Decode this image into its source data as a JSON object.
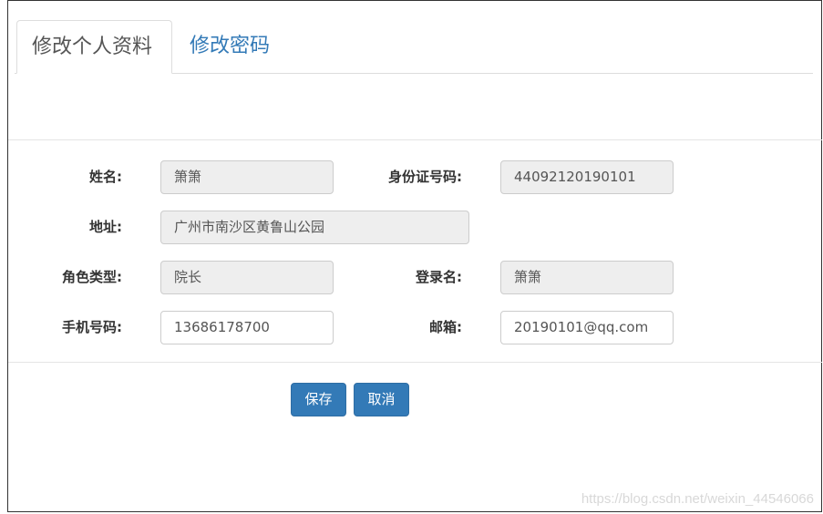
{
  "tabs": [
    {
      "label": "修改个人资料",
      "active": true
    },
    {
      "label": "修改密码",
      "active": false
    }
  ],
  "form": {
    "name": {
      "label": "姓名:",
      "value": "箫箫",
      "disabled": true
    },
    "id_card": {
      "label": "身份证号码:",
      "value": "44092120190101",
      "disabled": true
    },
    "address": {
      "label": "地址:",
      "value": "广州市南沙区黄鲁山公园",
      "disabled": true
    },
    "role": {
      "label": "角色类型:",
      "value": "院长",
      "disabled": true
    },
    "login": {
      "label": "登录名:",
      "value": "箫箫",
      "disabled": true
    },
    "phone": {
      "label": "手机号码:",
      "value": "13686178700",
      "disabled": false
    },
    "email": {
      "label": "邮箱:",
      "value": "20190101@qq.com",
      "disabled": false
    }
  },
  "buttons": {
    "save": "保存",
    "cancel": "取消"
  },
  "watermark": "https://blog.csdn.net/weixin_44546066",
  "colors": {
    "primary": "#337ab7",
    "disabled_bg": "#eeeeee"
  }
}
